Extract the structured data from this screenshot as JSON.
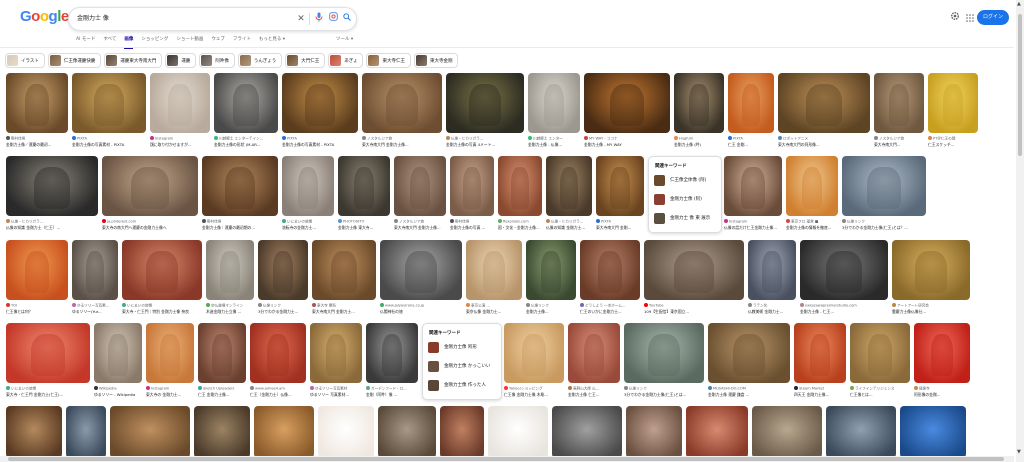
{
  "header": {
    "logo": "Google",
    "query": "金剛力士 像",
    "login_label": "ログイン",
    "icons": [
      "clear-icon",
      "mic-icon",
      "lens-icon",
      "search-icon",
      "settings-gear-icon",
      "apps-grid-icon"
    ]
  },
  "tabs": [
    {
      "label": "AI モード",
      "active": false
    },
    {
      "label": "すべて",
      "active": false
    },
    {
      "label": "画像",
      "active": true
    },
    {
      "label": "ショッピング",
      "active": false
    },
    {
      "label": "ショート動画",
      "active": false
    },
    {
      "label": "ウェブ",
      "active": false
    },
    {
      "label": "フライト",
      "active": false
    },
    {
      "label": "もっと見る ▾",
      "active": false
    }
  ],
  "tools_label": "ツール ▾",
  "chips": [
    {
      "label": "イラスト",
      "color": "#d9c9b6"
    },
    {
      "label": "仁王像運慶快慶",
      "color": "#7a5a38"
    },
    {
      "label": "運慶東大寺南大門",
      "color": "#5a4632"
    },
    {
      "label": "運慶",
      "color": "#3a3028"
    },
    {
      "label": "阿吽像",
      "color": "#5a5048"
    },
    {
      "label": "うんぎょう",
      "color": "#8a6a46"
    },
    {
      "label": "大門仁王",
      "color": "#6a4a2a"
    },
    {
      "label": "あぎょ",
      "color": "#c24a36"
    },
    {
      "label": "東大寺仁王",
      "color": "#8a6038"
    },
    {
      "label": "東大寺金剛",
      "color": "#4a3a2e"
    }
  ],
  "rows": [
    [
      {
        "src": "野村佳男",
        "title": "金剛力士像／運慶の最初...",
        "colors": [
          "#6a4a2a",
          "#c8a06a"
        ],
        "fav": "#555"
      },
      {
        "src": "PIXTA",
        "title": "金剛力士像の写真素材 - PIXTA",
        "colors": [
          "#7a5a2c",
          "#d6ac60"
        ],
        "fav": "#2a6dd8"
      },
      {
        "src": "Instagram",
        "title": "顔に取り付かせますが...",
        "colors": [
          "#b8aa9c",
          "#e4dcd2"
        ],
        "fav": "#c13584"
      },
      {
        "src": "川越郷土 エンターテイン...",
        "title": "金剛力士像の形状 (M-AR...",
        "colors": [
          "#4a4a4a",
          "#b0aca6"
        ],
        "fav": "#3b7"
      },
      {
        "src": "PIXTA",
        "title": "金剛力士像の写真素材 - PIXTA",
        "colors": [
          "#5a3c1e",
          "#c48e46"
        ],
        "fav": "#2a6dd8"
      },
      {
        "src": "ノスタルジア旅",
        "title": "東大寺南大門 金剛力士像...",
        "colors": [
          "#6e4e32",
          "#b8926a"
        ],
        "fav": "#888"
      },
      {
        "src": "仏像・ヒカリガラ...",
        "title": "金剛力士像の写真 4メート...",
        "colors": [
          "#2c2c22",
          "#7a7446"
        ],
        "fav": "#b85"
      },
      {
        "src": "川越郷土 エンター",
        "title": "金剛力士像 - 仏像...",
        "colors": [
          "#9c9890",
          "#dcd8d0"
        ],
        "fav": "#3b7"
      },
      {
        "src": "MY WAY - ココナ",
        "title": "金剛力士像 - MY WAY",
        "colors": [
          "#4a2c14",
          "#c47830"
        ],
        "fav": "#c44"
      },
      {
        "src": "Hugfum",
        "title": "金剛力士像 (吽)",
        "colors": [
          "#3a3428",
          "#a89070"
        ],
        "fav": "#e84"
      },
      {
        "src": "PIXTA",
        "title": "仁王 金剛...",
        "colors": [
          "#c45c1e",
          "#e8a060"
        ],
        "fav": "#2a6dd8"
      },
      {
        "src": "ロボットアニメ",
        "title": "東大寺南大門の阿形像...",
        "colors": [
          "#5c4424",
          "#c09058"
        ],
        "fav": "#58a"
      },
      {
        "src": "ノスタルジア旅",
        "title": "東大寺南大門...",
        "colors": [
          "#6e5840",
          "#b89a78"
        ],
        "fav": "#888"
      },
      {
        "src": "PT@仁王の顔",
        "title": "仁王スケッチ...",
        "colors": [
          "#c8a020",
          "#f0d460"
        ],
        "fav": "#d84"
      }
    ],
    [
      {
        "src": "仏像・ヒカリガラ...",
        "title": "仏像の知識 金剛力士（仁王）...",
        "colors": [
          "#2a2a2a",
          "#8a8478"
        ],
        "fav": "#b85"
      },
      {
        "src": "ja.pinterest.com",
        "title": "東大寺の南大門へ運慶の金剛力士像へ",
        "colors": [
          "#6a5444",
          "#c4a88c"
        ],
        "fav": "#e60023"
      },
      {
        "src": "野村佳男",
        "title": "金剛力士像｜運慶の最初期の...",
        "colors": [
          "#5a3a22",
          "#b48a5e"
        ],
        "fav": "#555"
      },
      {
        "src": "いにまいの旅情",
        "title": "流転寺の金剛力士...",
        "colors": [
          "#8a8078",
          "#d0c8be"
        ],
        "fav": "#4a8"
      },
      {
        "src": "PHOTOHITO",
        "title": "金剛力士像 東大寺...",
        "colors": [
          "#3c3830",
          "#8a8070"
        ],
        "fav": "#59c"
      },
      {
        "src": "ノスタルジア旅",
        "title": "東大寺南大門 金剛力士像...",
        "colors": [
          "#6a5242",
          "#b09480"
        ],
        "fav": "#888"
      },
      {
        "src": "野村佳男",
        "title": "金剛力士像の写真 ...",
        "colors": [
          "#7a5c48",
          "#c8a48c"
        ],
        "fav": "#555"
      },
      {
        "src": "flexpixels.com",
        "title": "国・文化・金剛力士像...",
        "colors": [
          "#8a4a30",
          "#d89070"
        ],
        "fav": "#6a6"
      },
      {
        "src": "仏像・ヒカリガラ...",
        "title": "仏像の知識 金剛力士...",
        "colors": [
          "#4a3a2a",
          "#9c8464"
        ],
        "fav": "#b85"
      },
      {
        "src": "PIXTA",
        "title": "東大寺南大門 金剛...",
        "colors": [
          "#6a4420",
          "#c89050"
        ],
        "fav": "#2a6dd8"
      },
      {
        "src": "",
        "title": "",
        "colors": [
          "#ffffff",
          "#ffffff"
        ],
        "fav": "#fff"
      },
      {
        "src": "Instagram",
        "title": "仏像の話だけ仁王金剛力士像...",
        "colors": [
          "#6a4c3a",
          "#d4b49a"
        ],
        "fav": "#c13584"
      },
      {
        "src": "東京フロ 運営 ■",
        "title": "金剛力士像の情報を徹底...",
        "colors": [
          "#d08030",
          "#f0c890"
        ],
        "fav": "#d44"
      },
      {
        "src": "仏像リンク",
        "title": "3分でわかる金剛力士像(仁王)とは？...",
        "colors": [
          "#5a6a7a",
          "#b0bcc8"
        ],
        "fav": "#888"
      }
    ],
    [
      {
        "src": "TOI",
        "title": "仁王像とは何？",
        "colors": [
          "#c8501e",
          "#f09a50"
        ],
        "fav": "#d33"
      },
      {
        "src": "ゆるソリー写真素...",
        "title": "ゆるソリー(Yur...",
        "colors": [
          "#5a5048",
          "#a8a098"
        ],
        "fav": "#b6a"
      },
      {
        "src": "いにまいの旅情",
        "title": "東大寺・仁王門｜特別 金剛力士像 奈良",
        "colors": [
          "#8a3828",
          "#d8886a"
        ],
        "fav": "#4a8"
      },
      {
        "src": "空仏道場オンライン",
        "title": "木造金剛力士立像 ...",
        "colors": [
          "#8a8478",
          "#d0ccc4"
        ],
        "fav": "#5a5"
      },
      {
        "src": "仏像リンク",
        "title": "3分でわかる金剛力士...",
        "colors": [
          "#4a3a2a",
          "#a48060"
        ],
        "fav": "#888"
      },
      {
        "src": "東大寺 関系",
        "title": "東大寺南大門 金剛力士...",
        "colors": [
          "#6a4a2a",
          "#c09060"
        ],
        "fav": "#a55"
      },
      {
        "src": "www.jalyouirone.co.jp",
        "title": "仏閣神社の旅",
        "colors": [
          "#4a4a4a",
          "#a8a8a8"
        ],
        "fav": "#4a6"
      },
      {
        "src": "東京公演 ...",
        "title": "東京仏像 金剛力士...",
        "colors": [
          "#b8946a",
          "#ecd6b4"
        ],
        "fav": "#d84"
      },
      {
        "src": "仏像リンク",
        "title": "金剛力士像...",
        "colors": [
          "#3a4a30",
          "#8a9c70"
        ],
        "fav": "#888"
      },
      {
        "src": "どうしよう 一本ホーム...",
        "title": "仁王のいかに金剛力士...",
        "colors": [
          "#6a3c28",
          "#b8806a"
        ],
        "fav": "#76a"
      },
      {
        "src": "YouTube",
        "title": "109【生配信】東京国立...",
        "colors": [
          "#5a4a3c",
          "#b0a090"
        ],
        "fav": "#f00"
      },
      {
        "src": "ラテン化",
        "title": "仏教美術 金剛力士...",
        "colors": [
          "#4a5060",
          "#a0a8b8"
        ],
        "fav": "#888"
      },
      {
        "src": "nakazawapremierstudio.com",
        "title": "金剛力士像 - 仁王...",
        "colors": [
          "#2a2a2a",
          "#7a7a7a"
        ],
        "fav": "#a88"
      },
      {
        "src": "アートアート研究会",
        "title": "雲慶力士像仏像仕...",
        "colors": [
          "#8a6a2a",
          "#d8b060"
        ],
        "fav": "#b84"
      }
    ],
    [
      {
        "src": "いにまいの旅情",
        "title": "東大寺・仁王門 金剛力士(仁王)...",
        "colors": [
          "#c4382a",
          "#f08a70"
        ],
        "fav": "#4a8"
      },
      {
        "src": "Wikipedia",
        "title": "ゆるソリー - Wikipedia",
        "colors": [
          "#8a7a6a",
          "#d4c8b8"
        ],
        "fav": "#333"
      },
      {
        "src": "Instagram",
        "title": "東大寺の 金剛力士...",
        "colors": [
          "#c8783a",
          "#ecb078"
        ],
        "fav": "#c13584"
      },
      {
        "src": "Sketch Uploaders",
        "title": "仁王 金剛力士像...",
        "colors": [
          "#6a4030",
          "#c08870"
        ],
        "fav": "#3a9"
      },
      {
        "src": "www.aimee4.am",
        "title": "仁王（金剛力士）仏像...",
        "colors": [
          "#a03020",
          "#e06a50"
        ],
        "fav": "#888"
      },
      {
        "src": "ゆるソリー写真素材",
        "title": "ゆるソリー 写真素材...",
        "colors": [
          "#8a6a3a",
          "#d8b070"
        ],
        "fav": "#b6a"
      },
      {
        "src": "ガーデンフード・ロ...",
        "title": "金剛（阿吽）像 ...",
        "colors": [
          "#3a3a3a",
          "#9a9a9a"
        ],
        "fav": "#5a8"
      },
      {
        "src": "",
        "title": "",
        "colors": [
          "#ffffff",
          "#ffffff"
        ],
        "fav": "#fff"
      },
      {
        "src": "Yahoo!ショッピング",
        "title": "仁王像 金剛力士像 木彫...",
        "colors": [
          "#c89a60",
          "#f0d0a0"
        ],
        "fav": "#f33"
      },
      {
        "src": "高野山大師 仏...",
        "title": "金剛力士像 仁王...",
        "colors": [
          "#9a4a3a",
          "#d8907a"
        ],
        "fav": "#a74"
      },
      {
        "src": "仏像リンク",
        "title": "3分でわかる金剛力士像(仁王)とは...",
        "colors": [
          "#5a6a60",
          "#a8b8ae"
        ],
        "fav": "#888"
      },
      {
        "src": "MUSASHI-DO.COM",
        "title": "金剛力士像 運慶 鎌倉 ...",
        "colors": [
          "#6a5030",
          "#b8966a"
        ],
        "fav": "#48a"
      },
      {
        "src": "Steam Market",
        "title": "四天王 金剛力士像...",
        "colors": [
          "#b8401e",
          "#ec8858"
        ],
        "fav": "#1b2838"
      },
      {
        "src": "ライフインテリジェンス",
        "title": "仁王像とは...",
        "colors": [
          "#8a6a3a",
          "#d0a868"
        ],
        "fav": "#7a4"
      },
      {
        "src": "極楽寺",
        "title": "阿形像の金剛...",
        "colors": [
          "#c02018",
          "#f06a58"
        ],
        "fav": "#c84"
      }
    ]
  ],
  "related_boxes": [
    {
      "header": "関連キーワード",
      "items": [
        {
          "label": "仁王像全体像 (阿)",
          "color": "#6a4a2a"
        },
        {
          "label": "金剛力士像 (阿)",
          "color": "#8a4030"
        },
        {
          "label": "金剛力士 像 東 展示",
          "color": "#5a5040"
        }
      ]
    },
    {
      "header": "関連キーワード",
      "items": [
        {
          "label": "金剛力士像 阿形",
          "color": "#8a3a28"
        },
        {
          "label": "金剛力士像 かっこいい",
          "color": "#6a5040"
        },
        {
          "label": "金剛力士像 作った人",
          "color": "#5a4638"
        }
      ]
    }
  ]
}
